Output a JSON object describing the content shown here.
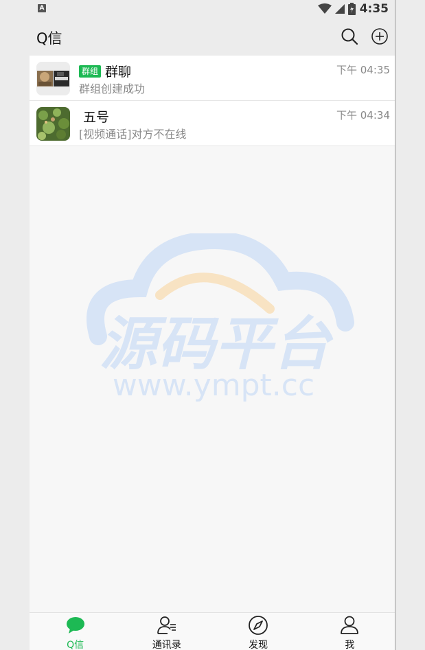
{
  "status_bar": {
    "app_icon": "A",
    "time": "4:35"
  },
  "header": {
    "title": "Q信",
    "search_icon": "search-icon",
    "add_icon": "plus-circle-icon"
  },
  "chats": [
    {
      "tag": "群组",
      "name": "群聊",
      "time": "下午 04:35",
      "preview": "群组创建成功"
    },
    {
      "tag": "",
      "name": "五号",
      "time": "下午 04:34",
      "preview": "[视频通话]对方不在线"
    }
  ],
  "watermark": {
    "title": "源码平台",
    "url": "www.ympt.cc"
  },
  "tabs": [
    {
      "label": "Q信",
      "icon": "chat-bubble-icon",
      "active": true
    },
    {
      "label": "通讯录",
      "icon": "contacts-icon",
      "active": false
    },
    {
      "label": "发现",
      "icon": "compass-icon",
      "active": false
    },
    {
      "label": "我",
      "icon": "person-icon",
      "active": false
    }
  ],
  "colors": {
    "accent": "#1db954",
    "header_bg": "#ececec"
  }
}
